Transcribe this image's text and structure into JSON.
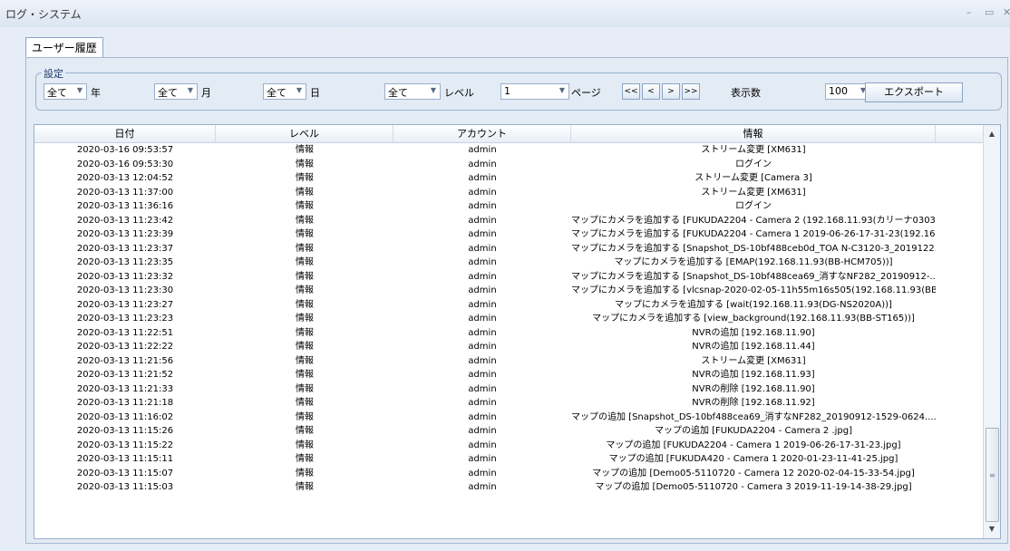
{
  "window": {
    "title": "ログ・システム",
    "min": "–",
    "max": "▭",
    "close": "✕"
  },
  "tab": {
    "label": "ユーザー履歴"
  },
  "settings": {
    "legend": "設定",
    "year": {
      "value": "全て",
      "label": "年"
    },
    "month": {
      "value": "全て",
      "label": "月"
    },
    "day": {
      "value": "全て",
      "label": "日"
    },
    "level": {
      "value": "全て",
      "label": "レベル"
    },
    "page": {
      "value": "1",
      "label": "ページ"
    },
    "nav": {
      "first": "<<",
      "prev": "<",
      "next": ">",
      "last": ">>"
    },
    "count": {
      "label": "表示数",
      "value": "100"
    },
    "export_label": "エクスポート"
  },
  "table": {
    "columns": [
      "日付",
      "レベル",
      "アカウント",
      "情報"
    ],
    "rows": [
      [
        "2020-03-16 09:53:57",
        "情報",
        "admin",
        "ストリーム変更 [XM631]"
      ],
      [
        "2020-03-16 09:53:30",
        "情報",
        "admin",
        "ログイン"
      ],
      [
        "2020-03-13 12:04:52",
        "情報",
        "admin",
        "ストリーム変更 [Camera 3]"
      ],
      [
        "2020-03-13 11:37:00",
        "情報",
        "admin",
        "ストリーム変更 [XM631]"
      ],
      [
        "2020-03-13 11:36:16",
        "情報",
        "admin",
        "ログイン"
      ],
      [
        "2020-03-13 11:23:42",
        "情報",
        "admin",
        "マップにカメラを追加する [FUKUDA2204 - Camera 2 (192.168.11.93(カリーナ0303 ..."
      ],
      [
        "2020-03-13 11:23:39",
        "情報",
        "admin",
        "マップにカメラを追加する [FUKUDA2204 - Camera 1 2019-06-26-17-31-23(192.16..."
      ],
      [
        "2020-03-13 11:23:37",
        "情報",
        "admin",
        "マップにカメラを追加する [Snapshot_DS-10bf488ceb0d_TOA N-C3120-3_2019122..."
      ],
      [
        "2020-03-13 11:23:35",
        "情報",
        "admin",
        "マップにカメラを追加する [EMAP(192.168.11.93(BB-HCM705))]"
      ],
      [
        "2020-03-13 11:23:32",
        "情報",
        "admin",
        "マップにカメラを追加する [Snapshot_DS-10bf488cea69_消すなNF282_20190912-..."
      ],
      [
        "2020-03-13 11:23:30",
        "情報",
        "admin",
        "マップにカメラを追加する [vlcsnap-2020-02-05-11h55m16s505(192.168.11.93(BB..."
      ],
      [
        "2020-03-13 11:23:27",
        "情報",
        "admin",
        "マップにカメラを追加する [wait(192.168.11.93(DG-NS2020A))]"
      ],
      [
        "2020-03-13 11:23:23",
        "情報",
        "admin",
        "マップにカメラを追加する [view_background(192.168.11.93(BB-ST165))]"
      ],
      [
        "2020-03-13 11:22:51",
        "情報",
        "admin",
        "NVRの追加 [192.168.11.90]"
      ],
      [
        "2020-03-13 11:22:22",
        "情報",
        "admin",
        "NVRの追加 [192.168.11.44]"
      ],
      [
        "2020-03-13 11:21:56",
        "情報",
        "admin",
        "ストリーム変更 [XM631]"
      ],
      [
        "2020-03-13 11:21:52",
        "情報",
        "admin",
        "NVRの追加 [192.168.11.93]"
      ],
      [
        "2020-03-13 11:21:33",
        "情報",
        "admin",
        "NVRの削除 [192.168.11.90]"
      ],
      [
        "2020-03-13 11:21:18",
        "情報",
        "admin",
        "NVRの削除 [192.168.11.92]"
      ],
      [
        "2020-03-13 11:16:02",
        "情報",
        "admin",
        "マップの追加 [Snapshot_DS-10bf488cea69_消すなNF282_20190912-1529-0624...."
      ],
      [
        "2020-03-13 11:15:26",
        "情報",
        "admin",
        "マップの追加 [FUKUDA2204 - Camera 2 .jpg]"
      ],
      [
        "2020-03-13 11:15:22",
        "情報",
        "admin",
        "マップの追加 [FUKUDA2204 - Camera 1 2019-06-26-17-31-23.jpg]"
      ],
      [
        "2020-03-13 11:15:11",
        "情報",
        "admin",
        "マップの追加 [FUKUDA420 - Camera 1 2020-01-23-11-41-25.jpg]"
      ],
      [
        "2020-03-13 11:15:07",
        "情報",
        "admin",
        "マップの追加 [Demo05-5110720 - Camera 12 2020-02-04-15-33-54.jpg]"
      ],
      [
        "2020-03-13 11:15:03",
        "情報",
        "admin",
        "マップの追加 [Demo05-5110720 - Camera 3 2019-11-19-14-38-29.jpg]"
      ]
    ]
  }
}
